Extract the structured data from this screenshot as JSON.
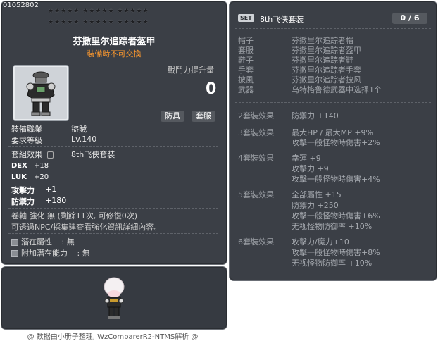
{
  "item": {
    "id": "01052802",
    "name": "芬撒里尔追踪者盔甲",
    "trade_note": "裝備時不可交換",
    "power_label": "戰鬥力提升量",
    "power_value": "0",
    "tags": [
      "防具",
      "套服"
    ],
    "job_label": "裝備職業",
    "job_value": "盜賊",
    "level_label": "要求等級",
    "level_value": "Lv.140",
    "set_effect_label": "套組效果",
    "set_effect_value": "8th飞侠套装",
    "stats": [
      {
        "name": "DEX",
        "value": "+18"
      },
      {
        "name": "LUK",
        "value": "+20"
      },
      {
        "name": "攻擊力",
        "value": "+1"
      },
      {
        "name": "防禦力",
        "value": "+180"
      }
    ],
    "scroll_note": "卷軸 強化 無 (剩餘11次, 可修復0次)",
    "enhance_note": "可透過NPC/採集建查看強化資訊詳細內容。",
    "potential_label": "潛在屬性",
    "potential_value": ": 無",
    "bonus_potential_label": "附加潛在能力",
    "bonus_potential_value": ": 無"
  },
  "footer": "@ 数据由小册子整理, WzComparerR2-NTMS解析 @",
  "set": {
    "badge": "SET",
    "name": "8th飞侠套装",
    "count": "0 / 6",
    "parts": [
      {
        "slot": "帽子",
        "name": "芬撒里尔追踪者帽"
      },
      {
        "slot": "套服",
        "name": "芬撒里尔追踪者盔甲"
      },
      {
        "slot": "鞋子",
        "name": "芬撒里尔追踪者鞋"
      },
      {
        "slot": "手套",
        "name": "芬撒里尔追踪者手套"
      },
      {
        "slot": "披風",
        "name": "芬撒里尔追踪者披风"
      },
      {
        "slot": "武器",
        "name": "乌特格鲁德武器中选择1个"
      }
    ],
    "effects": [
      {
        "label": "2套裝效果",
        "lines": [
          "防禦力 +140"
        ]
      },
      {
        "label": "3套裝效果",
        "lines": [
          "最大HP / 最大MP +9%",
          "攻擊一般怪物時傷害+2%"
        ]
      },
      {
        "label": "4套裝效果",
        "lines": [
          "幸運 +9",
          "攻擊力 +9",
          "攻擊一般怪物時傷害+4%"
        ]
      },
      {
        "label": "5套裝效果",
        "lines": [
          "全部屬性 +15",
          "防禦力 +250",
          "攻擊一般怪物時傷害+6%",
          "无视怪物防御率 +10%"
        ]
      },
      {
        "label": "6套裝效果",
        "lines": [
          "攻擊力/魔力+10",
          "攻擊一般怪物時傷害+8%",
          "无视怪物防御率 +10%"
        ]
      }
    ]
  }
}
